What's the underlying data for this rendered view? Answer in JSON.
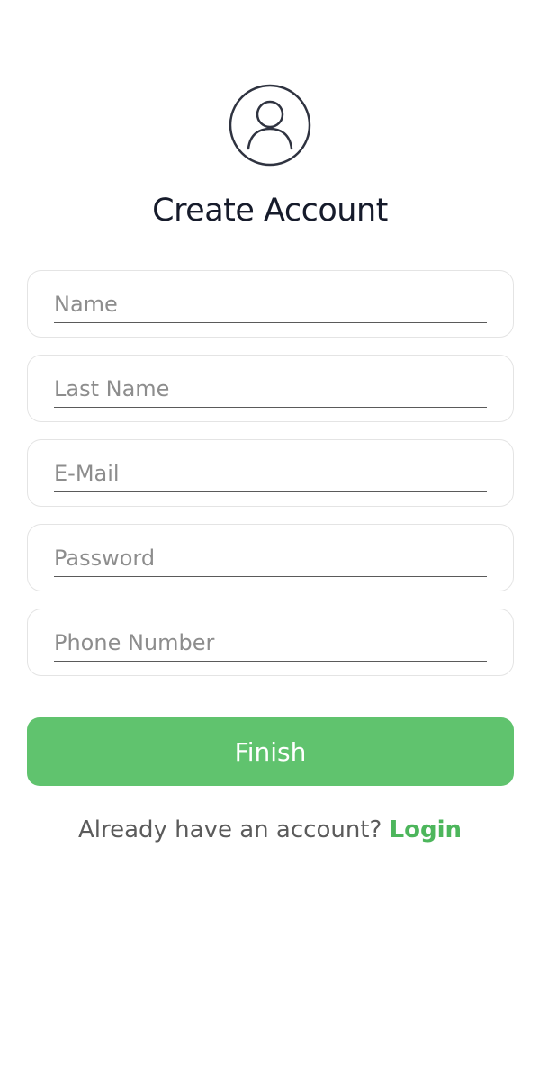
{
  "header": {
    "avatar_icon": "user-circle-icon",
    "title": "Create Account"
  },
  "form": {
    "fields": [
      {
        "placeholder": "Name",
        "value": ""
      },
      {
        "placeholder": "Last Name",
        "value": ""
      },
      {
        "placeholder": "E-Mail",
        "value": ""
      },
      {
        "placeholder": "Password",
        "value": ""
      },
      {
        "placeholder": "Phone Number",
        "value": ""
      }
    ],
    "submit_label": "Finish"
  },
  "footer": {
    "prompt": "Already have an account?",
    "link_label": "Login"
  },
  "colors": {
    "accent": "#60c36e",
    "link": "#4db65c",
    "title": "#161b2b",
    "border": "#e4e4e4"
  }
}
